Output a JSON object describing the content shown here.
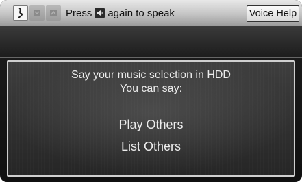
{
  "topbar": {
    "icons": [
      "voice-active-icon",
      "voice-inactive-icon",
      "voice-inactive-icon"
    ],
    "prompt_before": "Press",
    "prompt_icon": "talk-button-icon",
    "prompt_after": "again to speak",
    "voice_help_label": "Voice Help"
  },
  "panel": {
    "line1": "Say your music selection in HDD",
    "line2": "You can say:",
    "commands": [
      "Play Others",
      "List Others"
    ]
  },
  "colors": {
    "text_light": "#ececec",
    "topbar_light": "#e8e8e8",
    "screen_dark": "#1e1e1e"
  }
}
